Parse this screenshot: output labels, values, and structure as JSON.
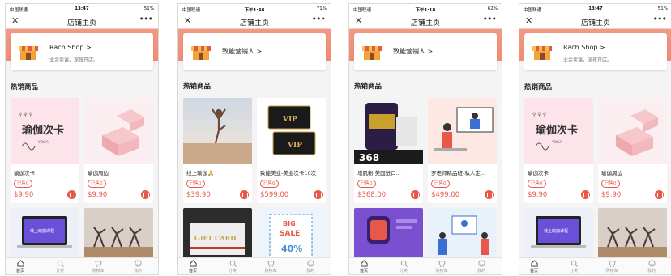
{
  "tabs": [
    {
      "label": "首页",
      "icon": "home-icon"
    },
    {
      "label": "分类",
      "icon": "search-icon"
    },
    {
      "label": "购物车",
      "icon": "cart-icon"
    },
    {
      "label": "我的",
      "icon": "user-icon"
    }
  ],
  "screens": [
    {
      "status": {
        "carrier": "中国联通",
        "time": "13:47",
        "battery": "51%"
      },
      "nav": {
        "title": "店铺主页",
        "close": "✕",
        "more": "•••"
      },
      "shop": {
        "name": "Rach Shop",
        "slogan": "业余卖课，深夜开店。"
      },
      "section_title": "热销商品",
      "products": [
        {
          "title": "瑜伽次卡",
          "tag": "已售0",
          "price": "$9.90",
          "image": "yoga-card-image"
        },
        {
          "title": "瑜伽周边",
          "tag": "已售0",
          "price": "$9.90",
          "image": "yoga-block-image"
        },
        {
          "image": "laptop-class-image"
        },
        {
          "image": "yoga-group-image"
        }
      ]
    },
    {
      "status": {
        "carrier": "中国联通",
        "time": "下午1:48",
        "battery": "71%"
      },
      "nav": {
        "title": "店铺主页",
        "close": "✕",
        "more": "•••"
      },
      "shop": {
        "name": "致能营销人",
        "slogan": ""
      },
      "section_title": "热销商品",
      "products": [
        {
          "title": "线上瑜伽🙏",
          "tag": "已售0",
          "price": "$39.90",
          "image": "yoga-beach-image"
        },
        {
          "title": "致能美业-美业次卡10次",
          "tag": "已售0",
          "price": "$599.00",
          "image": "vip-card-image"
        },
        {
          "image": "gift-card-image"
        },
        {
          "image": "big-sale-image"
        }
      ]
    },
    {
      "status": {
        "carrier": "中国联通",
        "time": "下午1:18",
        "battery": "62%"
      },
      "nav": {
        "title": "店铺主页",
        "close": "✕",
        "more": "•••"
      },
      "shop": {
        "name": "致能营销人",
        "slogan": ""
      },
      "section_title": "热销商品",
      "products": [
        {
          "title": "增肌粉 美国进口...",
          "tag": "已售0",
          "price": "$368.00",
          "image": "protein-image"
        },
        {
          "title": "罗老师精品班-私人定...",
          "tag": "已售0",
          "price": "$499.00",
          "image": "teacher-image"
        },
        {
          "image": "smartwatch-image"
        },
        {
          "image": "meeting-image"
        }
      ]
    },
    {
      "status": {
        "carrier": "中国联通",
        "time": "13:47",
        "battery": "51%"
      },
      "nav": {
        "title": "店铺主页",
        "close": "✕",
        "more": "•••"
      },
      "shop": {
        "name": "Rach Shop",
        "slogan": "业余卖课，深夜开店。"
      },
      "section_title": "热销商品",
      "products": [
        {
          "title": "瑜伽次卡",
          "tag": "已售0",
          "price": "$9.90",
          "image": "yoga-card-image"
        },
        {
          "title": "瑜伽周边",
          "tag": "已售0",
          "price": "$9.90",
          "image": "yoga-block-image"
        },
        {
          "image": "laptop-class-image"
        },
        {
          "image": "yoga-group-image"
        }
      ]
    }
  ],
  "image_text": {
    "yoga_card": "瑜伽次卡",
    "yoga_card_sub": "YOGA",
    "vip": "VIP",
    "gift_card": "GIFT CARD",
    "big_sale": "BIG SALE",
    "sale_pct": "40%",
    "protein_price": "368",
    "laptop_banner": "线上瑜伽课程"
  },
  "colors": {
    "accent": "#e8584a",
    "header": "#f28a73"
  }
}
